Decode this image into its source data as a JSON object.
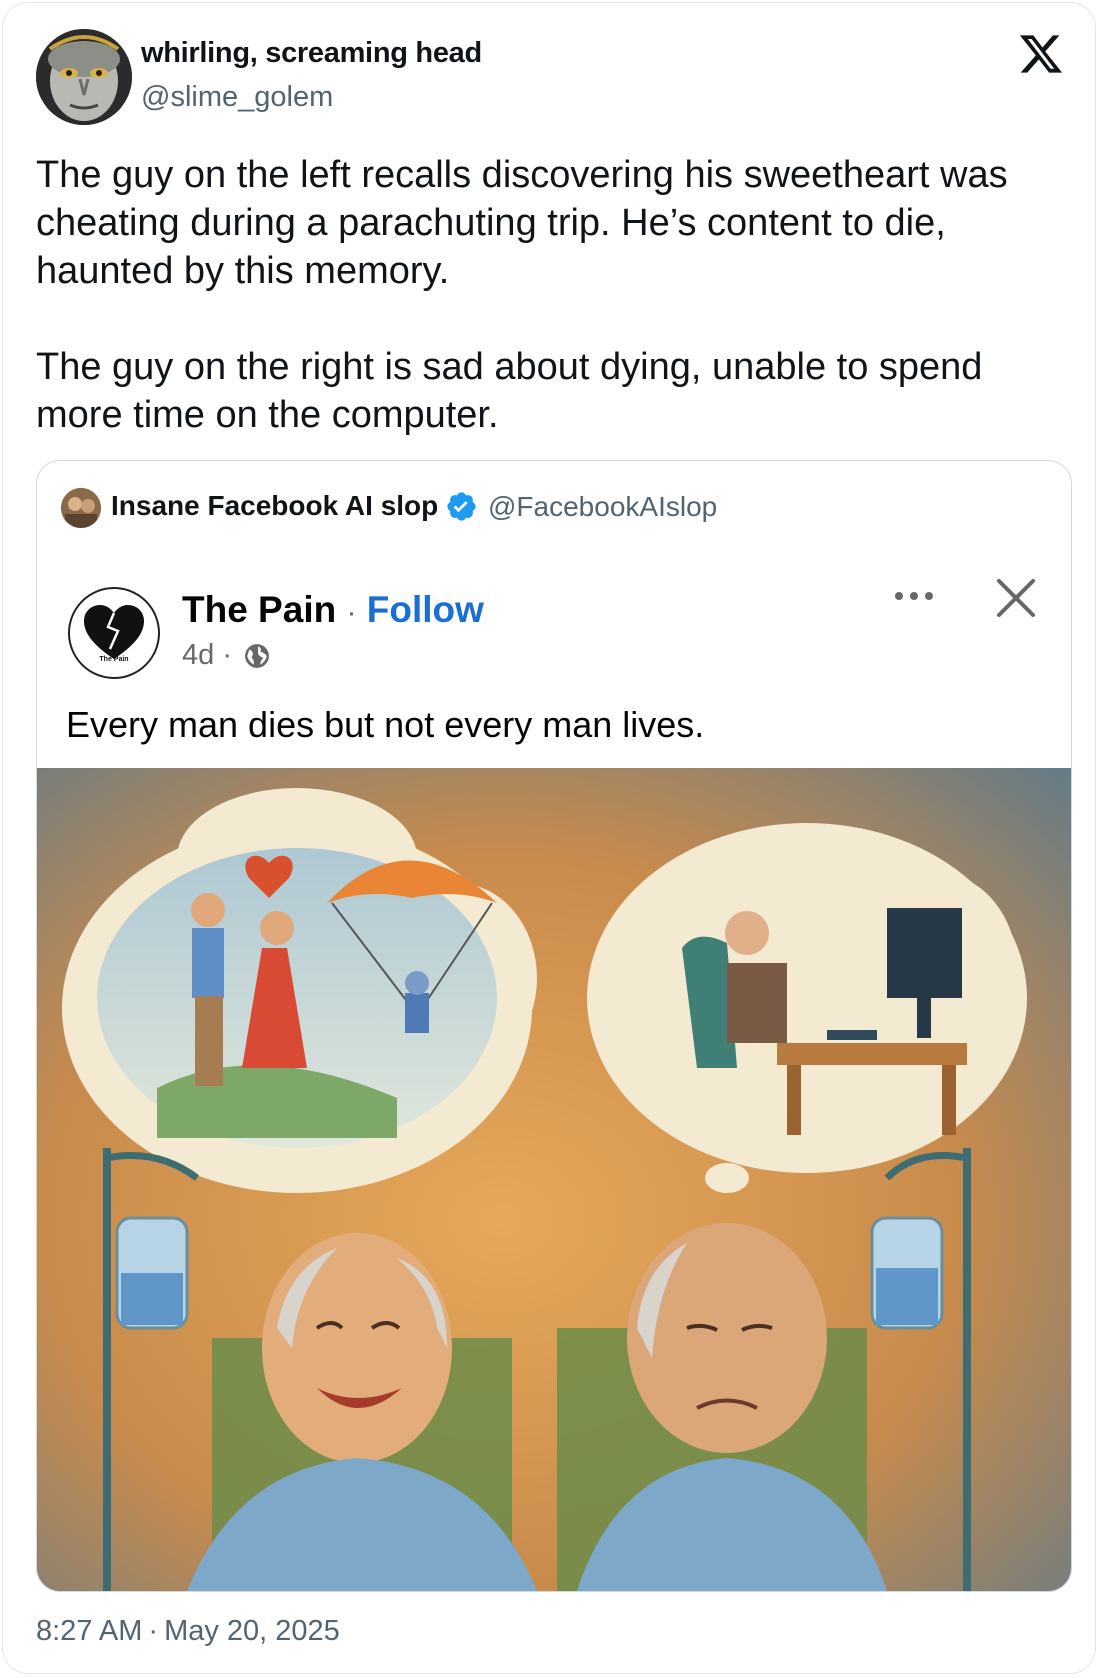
{
  "tweet": {
    "author": {
      "display_name": "whirling, screaming head",
      "handle": "@slime_golem"
    },
    "brand_icon": "x-logo-icon",
    "text_paragraphs": [
      "The guy on the left recalls discovering his sweetheart was cheating during a parachuting trip. He’s content to die, haunted by this memory.",
      "The guy on the right is sad about dying, unable to spend more time on the computer."
    ],
    "time": "8:27 AM",
    "separator": "·",
    "date": "May 20, 2025"
  },
  "quoted": {
    "display_name": "Insane Facebook AI slop",
    "verified": true,
    "handle": "@FacebookAIslop",
    "fb_post": {
      "page_name": "The Pain",
      "separator": "·",
      "follow_label": "Follow",
      "age": "4d",
      "visibility_icon": "globe-icon",
      "avatar_label": "The Pain",
      "text": "Every man dies but not every man lives."
    }
  },
  "colors": {
    "follow_blue": "#1a6fd1",
    "verified_blue": "#1d9bf0",
    "muted": "#536471"
  }
}
